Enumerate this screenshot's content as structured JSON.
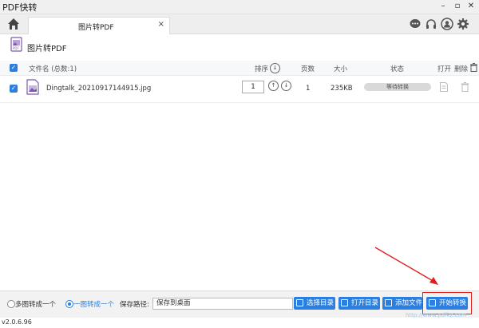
{
  "window": {
    "title": "PDF快转"
  },
  "tab": {
    "label": "图片转PDF",
    "close": "×"
  },
  "section": {
    "title": "图片转PDF"
  },
  "columns": {
    "filename": "文件名 (总数:1)",
    "order": "排序",
    "pages": "页数",
    "size": "大小",
    "status": "状态",
    "open": "打开",
    "delete": "删除"
  },
  "files": [
    {
      "name": "Dingtalk_20210917144915.jpg",
      "order": "1",
      "pages": "1",
      "size": "235KB",
      "status": "等待转换"
    }
  ],
  "bottom": {
    "mode_multi": "多图转成一个",
    "mode_single": "一图转成一个",
    "save_path_label": "保存路径:",
    "save_path_value": "保存到桌面",
    "choose_dir": "选择目录",
    "open_dir": "打开目录",
    "add_file": "添加文件",
    "start": "开始转换"
  },
  "version": "v2.0.6.96",
  "watermark": "http://www.pdfkz.com",
  "colors": {
    "accent": "#2b7fe0",
    "highlight": "#e02020"
  }
}
